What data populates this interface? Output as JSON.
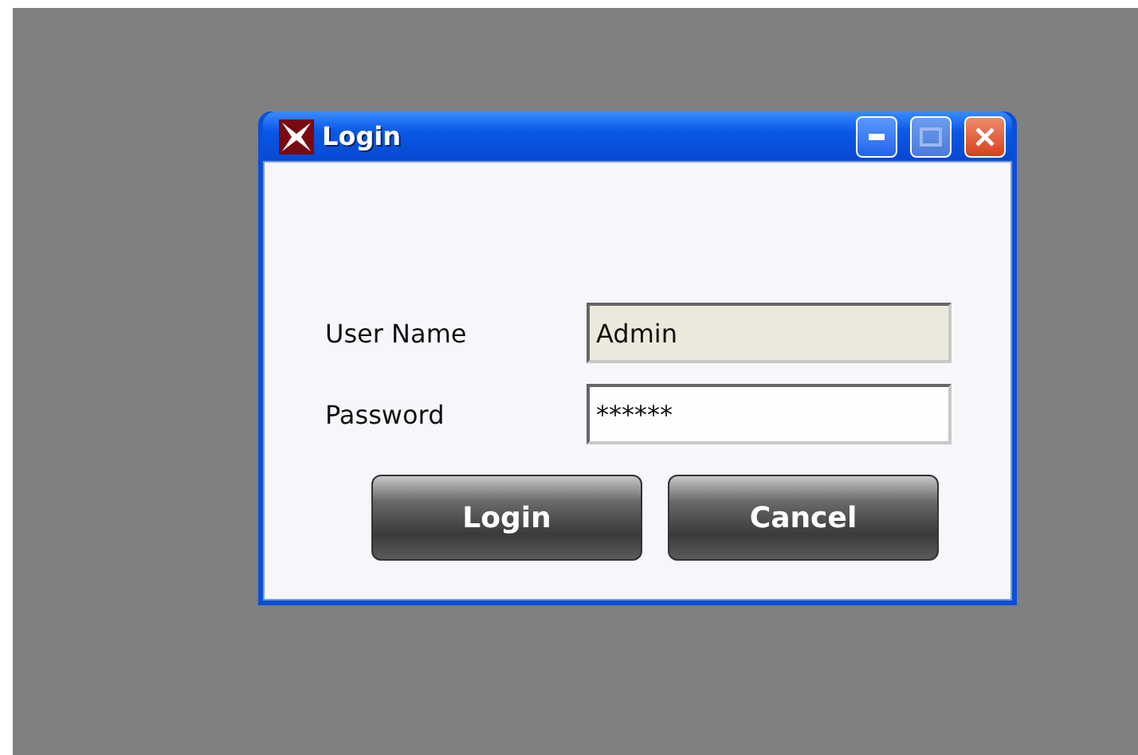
{
  "window": {
    "title": "Login"
  },
  "fields": [
    {
      "label": "User Name",
      "value": "Admin",
      "readonly": true
    },
    {
      "label": "Password",
      "value": "******",
      "readonly": false
    }
  ],
  "buttons": [
    "Login",
    "Cancel"
  ]
}
